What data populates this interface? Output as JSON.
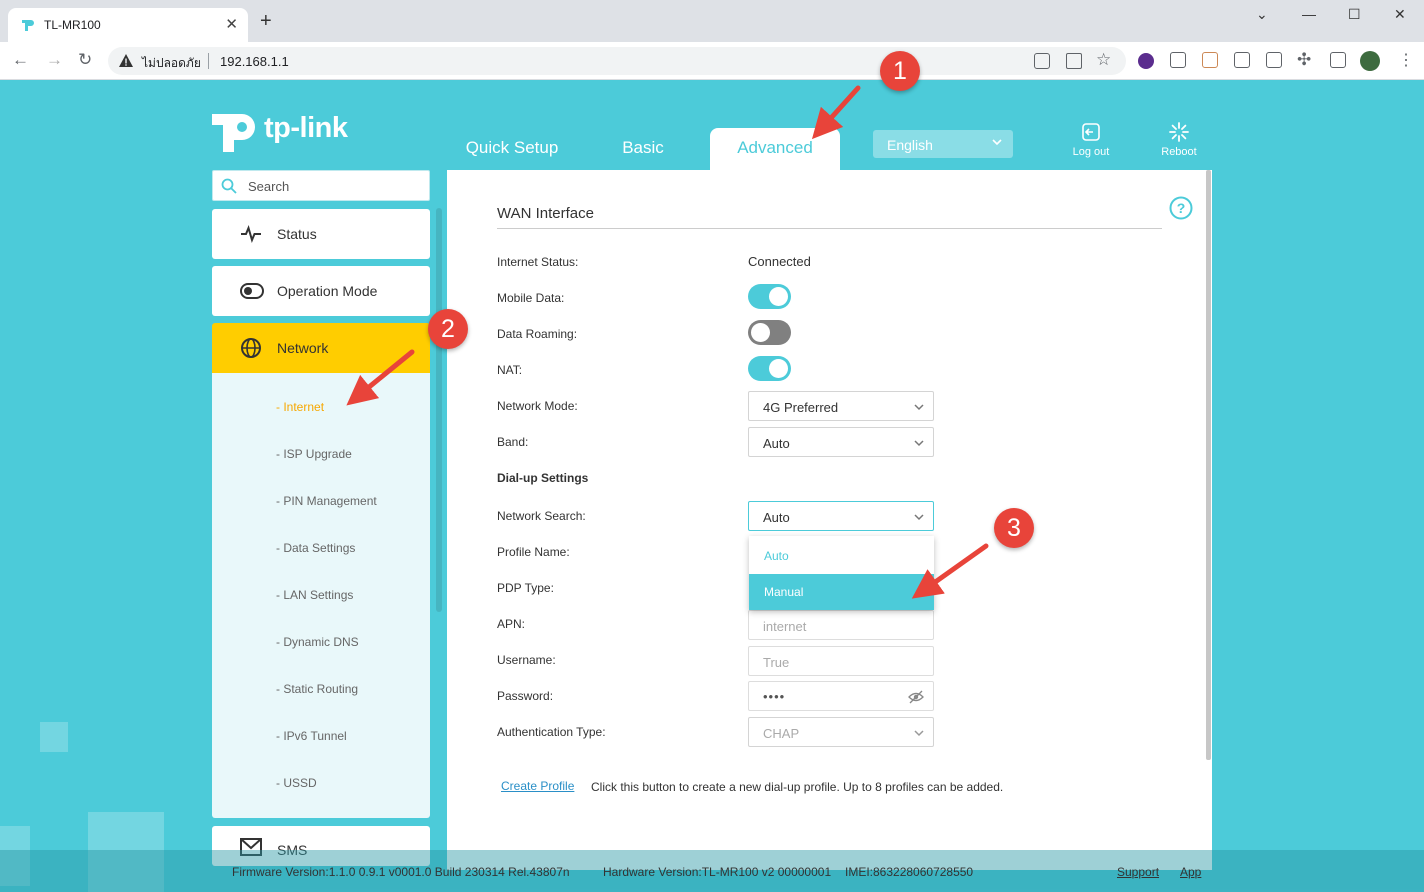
{
  "browser": {
    "tab_title": "TL-MR100",
    "insecure_label": "ไม่ปลอดภัย",
    "url": "192.168.1.1"
  },
  "brand": {
    "logo_text": "tp-link",
    "color": "#4ccbd9"
  },
  "nav_tabs": [
    {
      "label": "Quick Setup"
    },
    {
      "label": "Basic"
    },
    {
      "label": "Advanced",
      "active": true
    }
  ],
  "language": "English",
  "header_buttons": {
    "logout": "Log out",
    "reboot": "Reboot"
  },
  "sidebar": {
    "search_placeholder": "Search",
    "items": [
      {
        "label": "Status",
        "icon": "pulse-icon"
      },
      {
        "label": "Operation Mode",
        "icon": "toggle-icon"
      },
      {
        "label": "Network",
        "icon": "globe-icon",
        "active": true
      }
    ],
    "network_sub": [
      "- Internet",
      "- ISP Upgrade",
      "- PIN Management",
      "- Data Settings",
      "- LAN Settings",
      "- Dynamic DNS",
      "- Static Routing",
      "- IPv6 Tunnel",
      "- USSD"
    ],
    "sms_label": "SMS"
  },
  "panel": {
    "title": "WAN Interface",
    "internet_status_label": "Internet Status:",
    "internet_status_value": "Connected",
    "mobile_data_label": "Mobile Data:",
    "mobile_data_on": true,
    "data_roaming_label": "Data Roaming:",
    "data_roaming_on": false,
    "nat_label": "NAT:",
    "nat_on": true,
    "network_mode_label": "Network Mode:",
    "network_mode_value": "4G Preferred",
    "band_label": "Band:",
    "band_value": "Auto",
    "dialup_heading": "Dial-up Settings",
    "network_search_label": "Network Search:",
    "network_search_value": "Auto",
    "network_search_options": [
      "Auto",
      "Manual"
    ],
    "profile_name_label": "Profile Name:",
    "pdp_type_label": "PDP Type:",
    "apn_label": "APN:",
    "apn_value": "internet",
    "username_label": "Username:",
    "username_value": "True",
    "password_label": "Password:",
    "password_value": "••••",
    "auth_type_label": "Authentication Type:",
    "auth_type_value": "CHAP",
    "create_profile": "Create Profile",
    "create_profile_desc": "Click this button to create a new dial-up profile. Up to 8 profiles can be added."
  },
  "footer": {
    "firmware": "Firmware Version:1.1.0 0.9.1 v0001.0 Build 230314 Rel.43807n",
    "hardware": "Hardware Version:TL-MR100 v2 00000001",
    "imei": "IMEI:863228060728550",
    "support": "Support",
    "app": "App"
  },
  "annotations": {
    "badge1": "1",
    "badge2": "2",
    "badge3": "3"
  }
}
